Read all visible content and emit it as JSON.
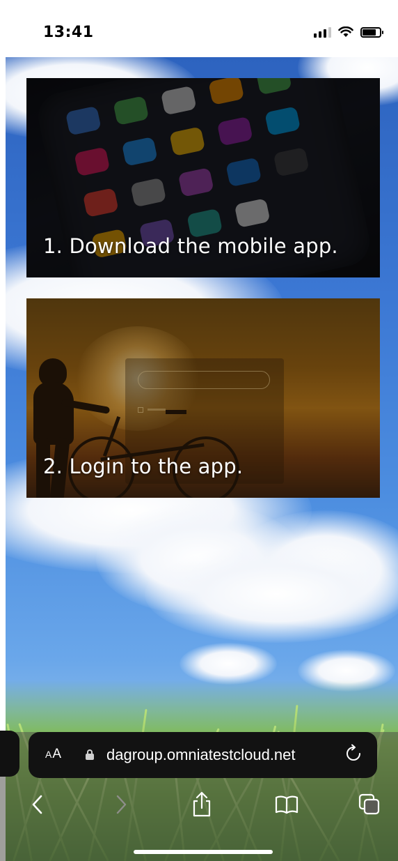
{
  "status_bar": {
    "time": "13:41",
    "icons": [
      "cellular-signal-icon",
      "wifi-icon",
      "battery-icon"
    ]
  },
  "cards": [
    {
      "label": "1. Download the mobile app.",
      "image": "phone-app-icons-photo"
    },
    {
      "label": "2. Login to the app.",
      "image": "cyclist-sunset-login-photo"
    }
  ],
  "address_bar": {
    "aa_label_big": "A",
    "aa_label_small": "A",
    "url": "dagroup.omniatestcloud.net",
    "icons": [
      "lock-icon",
      "reload-icon"
    ]
  },
  "toolbar": {
    "icons": [
      "back-icon",
      "forward-icon",
      "share-icon",
      "bookmarks-icon",
      "tabs-icon"
    ]
  },
  "colors": {
    "sky": "#3c78d4",
    "address_bar_bg": "#121212",
    "card_text": "#ffffff"
  }
}
